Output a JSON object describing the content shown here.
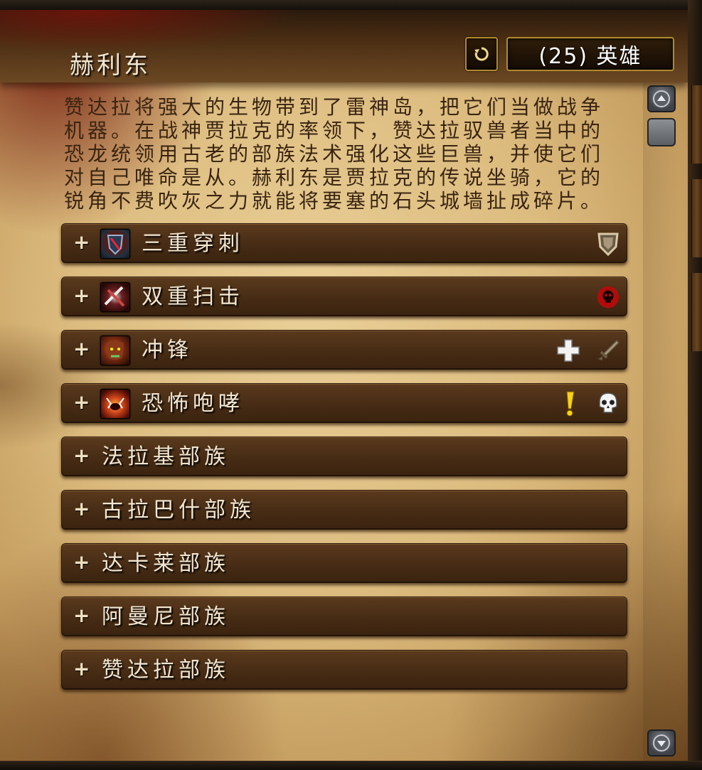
{
  "header": {
    "title": "赫利东",
    "difficulty": "(25) 英雄",
    "reset_icon": "undo-icon"
  },
  "description": "赞达拉将强大的生物带到了雷神岛，把它们当做战争机器。在战神贾拉克的率领下，赞达拉驭兽者当中的恐龙统领用古老的部族法术强化这些巨兽，并使它们对自己唯命是从。赫利东是贾拉克的传说坐骑，它的锐角不费吹灰之力就能将要塞的石头城墙扯成碎片。",
  "sections": [
    {
      "expander": "+",
      "label": "三重穿刺",
      "icon": "triple-puncture-ability-icon",
      "flags": [
        "tank-shield-icon"
      ]
    },
    {
      "expander": "+",
      "label": "双重扫击",
      "icon": "double-swipe-ability-icon",
      "flags": [
        "deadly-skull-icon"
      ]
    },
    {
      "expander": "+",
      "label": "冲锋",
      "icon": "charge-ability-icon",
      "flags": [
        "healer-cross-icon",
        "dps-sword-icon"
      ]
    },
    {
      "expander": "+",
      "label": "恐怖咆哮",
      "icon": "terrifying-roar-ability-icon",
      "flags": [
        "important-exclamation-icon",
        "lethal-skull-icon"
      ]
    },
    {
      "expander": "+",
      "label": "法拉基部族"
    },
    {
      "expander": "+",
      "label": "古拉巴什部族"
    },
    {
      "expander": "+",
      "label": "达卡莱部族"
    },
    {
      "expander": "+",
      "label": "阿曼尼部族"
    },
    {
      "expander": "+",
      "label": "赞达拉部族"
    }
  ],
  "scrollbar": {
    "up_icon": "scroll-up-icon",
    "down_icon": "scroll-down-icon"
  },
  "colors": {
    "parchment": "#dcbb7e",
    "section_bar": "#4a2e16",
    "gold_border": "#b08a2c",
    "title_text": "#f2e6d0",
    "body_text": "#3a2410"
  }
}
